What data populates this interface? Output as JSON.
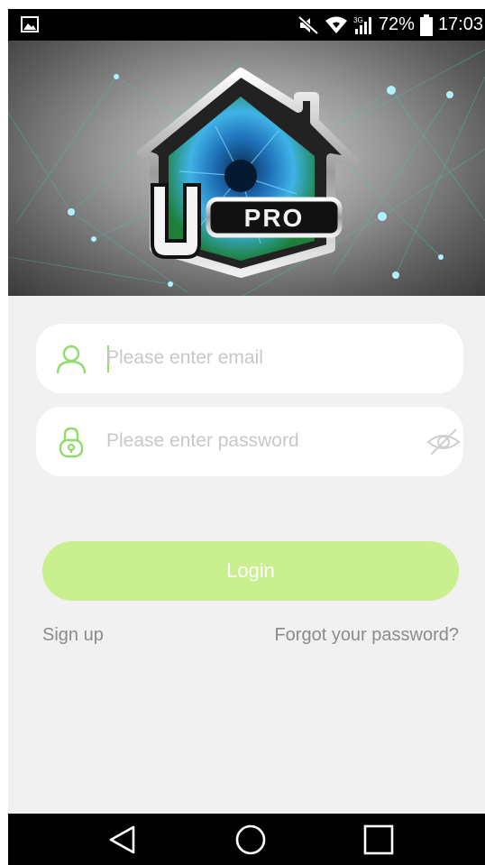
{
  "status_bar": {
    "battery": "72%",
    "time": "17:03",
    "icons": [
      "image-icon",
      "mute-icon",
      "wifi-icon",
      "signal-3g-icon",
      "battery-icon"
    ]
  },
  "hero": {
    "logo_text": "PRO",
    "logo_letter": "U"
  },
  "form": {
    "email": {
      "value": "",
      "placeholder": "Please enter email"
    },
    "password": {
      "value": "",
      "placeholder": "Please enter password"
    },
    "login_label": "Login",
    "signup_label": "Sign up",
    "forgot_label": "Forgot your password?"
  },
  "colors": {
    "accent_green": "#8fdc6b",
    "button_green": "#c9ef8f",
    "link_gray": "#8b8b8b",
    "background": "#f1f1f1"
  },
  "nav_bar": {
    "icons": [
      "back-icon",
      "home-icon",
      "recents-icon"
    ]
  }
}
